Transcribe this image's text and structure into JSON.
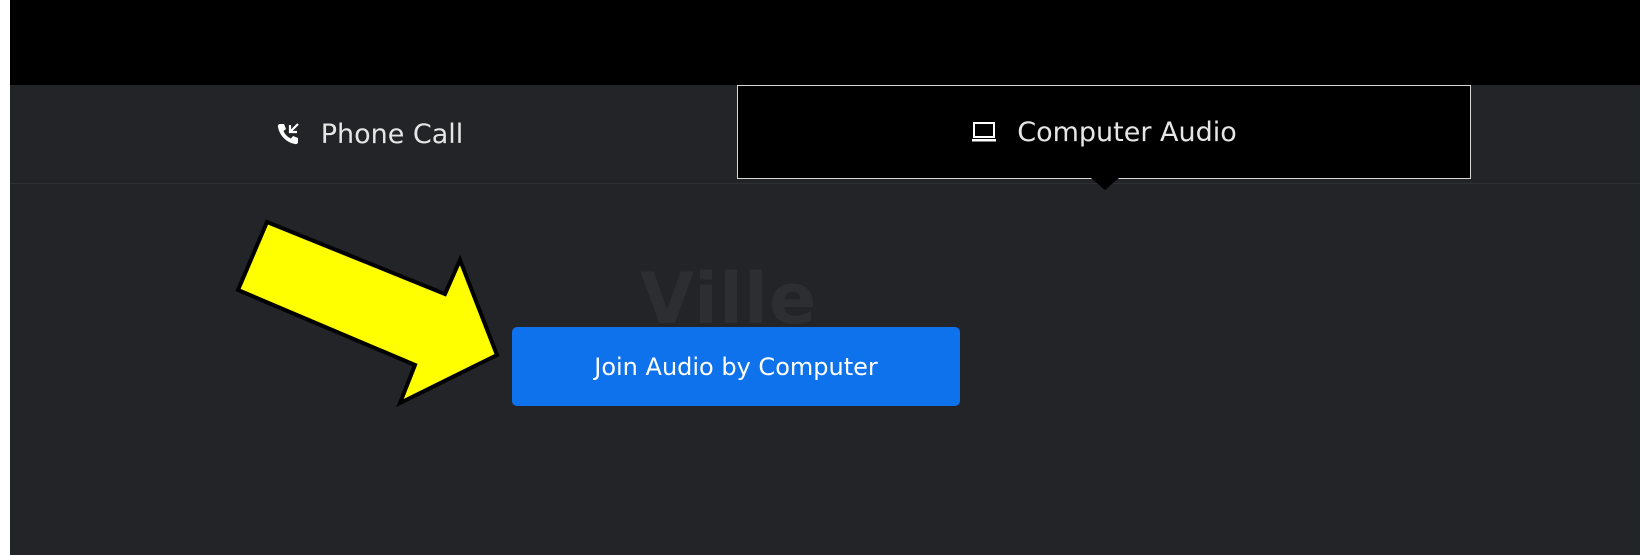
{
  "tabs": {
    "phone_call": {
      "label": "Phone Call",
      "icon": "phone-call-icon"
    },
    "computer_audio": {
      "label": "Computer Audio",
      "icon": "laptop-icon",
      "selected": true
    }
  },
  "background_text": "Ville",
  "join_button": {
    "label": "Join Audio by Computer"
  },
  "annotation": {
    "icon": "yellow-arrow-icon"
  },
  "colors": {
    "button": "#0e72ed",
    "panel": "#232427",
    "header": "#000000",
    "arrow_fill": "#ffff00",
    "arrow_stroke": "#000000"
  }
}
